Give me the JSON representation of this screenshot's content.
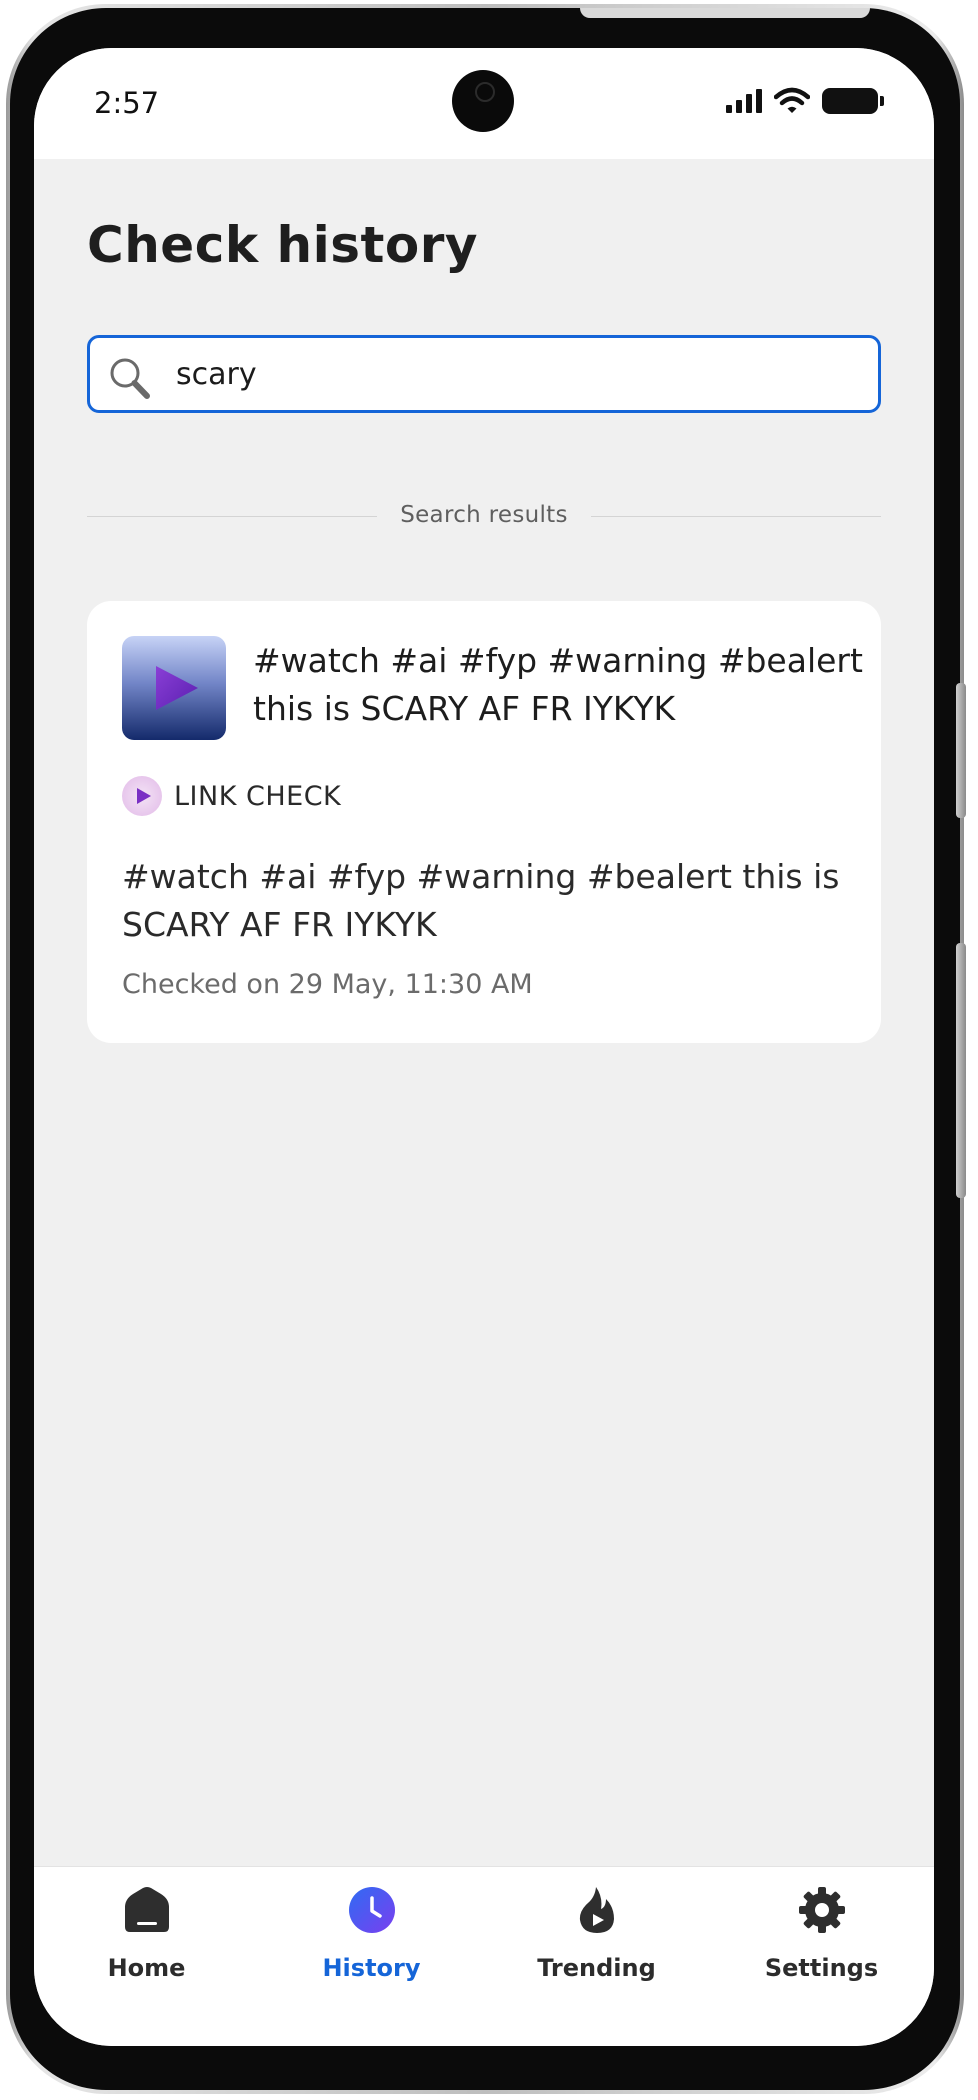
{
  "status_bar": {
    "time": "2:57"
  },
  "page": {
    "title": "Check history"
  },
  "search": {
    "value": "scary",
    "icon": "search-icon"
  },
  "results": {
    "label": "Search results",
    "items": [
      {
        "thumbnail_icon": "play-icon",
        "title": "#watch #ai #fyp #warning #bealert this is SCARY AF FR IYKYK",
        "type_icon": "play-icon",
        "type_label": "LINK CHECK",
        "body": "#watch #ai #fyp #warning #bealert this is SCARY AF FR IYKYK",
        "checked_on": "Checked on 29 May, 11:30 AM"
      }
    ]
  },
  "nav": {
    "active": "History",
    "active_color": "#1565d8",
    "items": [
      {
        "label": "Home",
        "icon": "home-icon"
      },
      {
        "label": "History",
        "icon": "clock-icon"
      },
      {
        "label": "Trending",
        "icon": "flame-icon"
      },
      {
        "label": "Settings",
        "icon": "gear-icon"
      }
    ]
  }
}
